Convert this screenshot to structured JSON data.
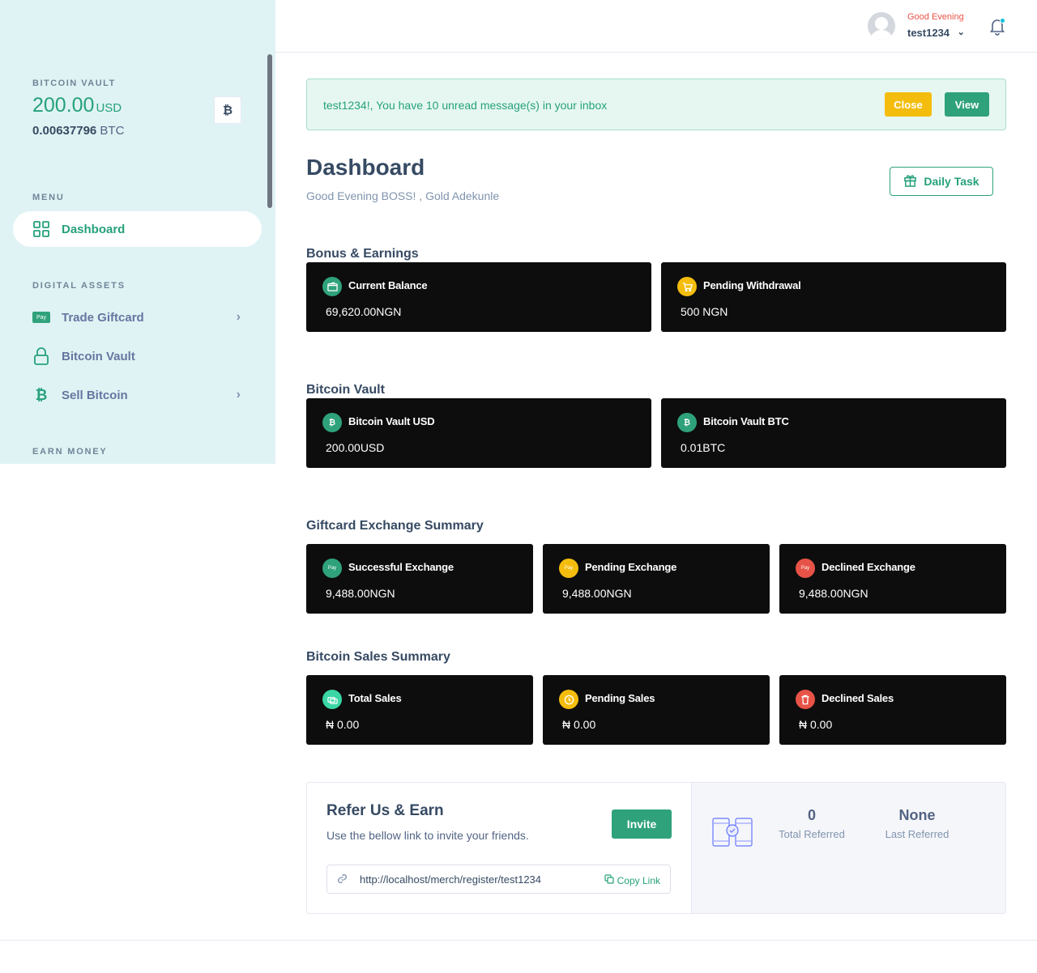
{
  "sidebar": {
    "vault_label": "BITCOIN VAULT",
    "vault_amount": "200.00",
    "vault_currency": "USD",
    "vault_btc_amount": "0.00637796",
    "vault_btc_unit": "BTC",
    "btc_symbol": "₿",
    "menu_label": "MENU",
    "dashboard_label": "Dashboard",
    "digital_assets_label": "DIGITAL ASSETS",
    "trade_giftcard_label": "Trade Giftcard",
    "bitcoin_vault_label": "Bitcoin Vault",
    "sell_bitcoin_label": "Sell Bitcoin",
    "earn_money_label": "EARN MONEY",
    "apple_pay_text": "Pay"
  },
  "header": {
    "greeting": "Good Evening",
    "username": "test1234",
    "chevron": "⌄"
  },
  "alert": {
    "prefix": "test1234!, You have ",
    "count": "10",
    "suffix": " unread message(s) in your inbox",
    "close_label": "Close",
    "view_label": "View"
  },
  "page": {
    "title": "Dashboard",
    "subtitle": "Good Evening BOSS! , Gold Adekunle",
    "daily_task_label": "Daily Task"
  },
  "sections": {
    "bonus": "Bonus & Earnings",
    "vault": "Bitcoin Vault",
    "giftcard": "Giftcard Exchange Summary",
    "sales": "Bitcoin Sales Summary"
  },
  "cards": {
    "current_balance": {
      "title": "Current Balance",
      "value": "69,620.00NGN"
    },
    "pending_withdrawal": {
      "title": "Pending Withdrawal",
      "value": "500 NGN"
    },
    "vault_usd": {
      "title": "Bitcoin Vault USD",
      "value": "200.00USD"
    },
    "vault_btc": {
      "title": "Bitcoin Vault BTC",
      "value": "0.01BTC"
    },
    "successful_exchange": {
      "title": "Successful Exchange",
      "value": "9,488.00NGN"
    },
    "pending_exchange": {
      "title": "Pending Exchange",
      "value": "9,488.00NGN"
    },
    "declined_exchange": {
      "title": "Declined Exchange",
      "value": "9,488.00NGN"
    },
    "total_sales": {
      "title": "Total Sales",
      "value": "₦ 0.00"
    },
    "pending_sales": {
      "title": "Pending Sales",
      "value": "₦ 0.00"
    },
    "declined_sales": {
      "title": "Declined Sales",
      "value": "₦ 0.00"
    }
  },
  "refer": {
    "title": "Refer Us & Earn",
    "subtitle": "Use the bellow link to invite your friends.",
    "invite_label": "Invite",
    "link": "http://localhost/merch/register/test1234",
    "copy_label": "Copy Link",
    "total_referred_value": "0",
    "total_referred_label": "Total Referred",
    "last_referred_value": "None",
    "last_referred_label": "Last Referred"
  },
  "colors": {
    "accent": "#26a17b",
    "warning": "#f4bd0e",
    "danger": "#e85347",
    "sidebar_bg": "#dff3f4",
    "card_bg": "#0d0d0d"
  }
}
